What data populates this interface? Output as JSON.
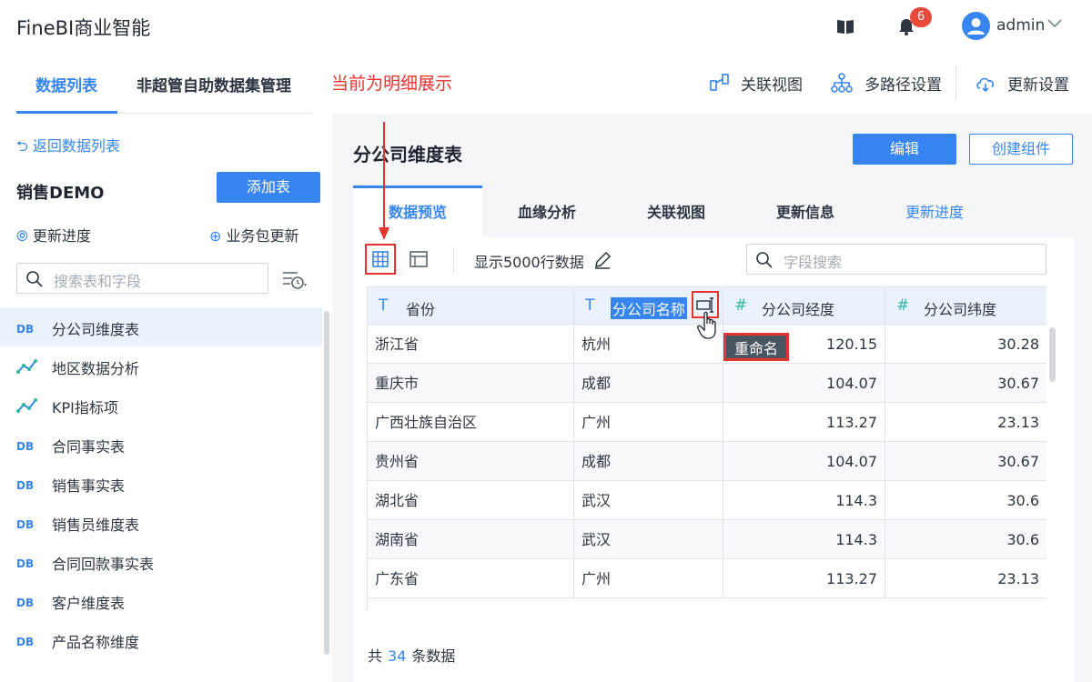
{
  "header": {
    "brand": "FineBI商业智能",
    "notification_count": "6",
    "user_name": "admin"
  },
  "nav": {
    "tabs": [
      "数据列表",
      "非超管自助数据集管理"
    ],
    "annotation": "当前为明细展示",
    "actions": [
      "关联视图",
      "多路径设置",
      "更新设置"
    ]
  },
  "sidebar": {
    "back_label": "返回数据列表",
    "package_title": "销售DEMO",
    "add_table_label": "添加表",
    "update_progress_label": "更新进度",
    "package_update_label": "业务包更新",
    "search_placeholder": "搜索表和字段",
    "items": [
      {
        "label": "分公司维度表",
        "type": "db"
      },
      {
        "label": "地区数据分析",
        "type": "analysis"
      },
      {
        "label": "KPI指标项",
        "type": "analysis"
      },
      {
        "label": "合同事实表",
        "type": "db"
      },
      {
        "label": "销售事实表",
        "type": "db"
      },
      {
        "label": "销售员维度表",
        "type": "db"
      },
      {
        "label": "合同回款事实表",
        "type": "db"
      },
      {
        "label": "客户维度表",
        "type": "db"
      },
      {
        "label": "产品名称维度",
        "type": "db"
      }
    ]
  },
  "main": {
    "title": "分公司维度表",
    "edit_label": "编辑",
    "create_component_label": "创建组件",
    "tabs": [
      "数据预览",
      "血缘分析",
      "关联视图",
      "更新信息",
      "更新进度"
    ],
    "rows_label": "显示5000行数据",
    "field_search_placeholder": "字段搜索",
    "columns": [
      {
        "type_mark": "T",
        "label": "省份"
      },
      {
        "type_mark": "T",
        "label": "分公司名称"
      },
      {
        "type_mark": "#",
        "label": "分公司经度"
      },
      {
        "type_mark": "#",
        "label": "分公司纬度"
      }
    ],
    "rows": [
      [
        "浙江省",
        "杭州",
        "120.15",
        "30.28"
      ],
      [
        "重庆市",
        "成都",
        "104.07",
        "30.67"
      ],
      [
        "广西壮族自治区",
        "广州",
        "113.27",
        "23.13"
      ],
      [
        "贵州省",
        "成都",
        "104.07",
        "30.67"
      ],
      [
        "湖北省",
        "武汉",
        "114.3",
        "30.6"
      ],
      [
        "湖南省",
        "武汉",
        "114.3",
        "30.6"
      ],
      [
        "广东省",
        "广州",
        "113.27",
        "23.13"
      ]
    ],
    "tooltip": "重命名",
    "total_prefix": "共",
    "total_count": "34",
    "total_suffix": "条数据"
  },
  "colors": {
    "accent": "#3685f2",
    "annotation": "#e8322f",
    "badge": "#e74a3b",
    "numeric_mark": "#2fb7a3"
  }
}
